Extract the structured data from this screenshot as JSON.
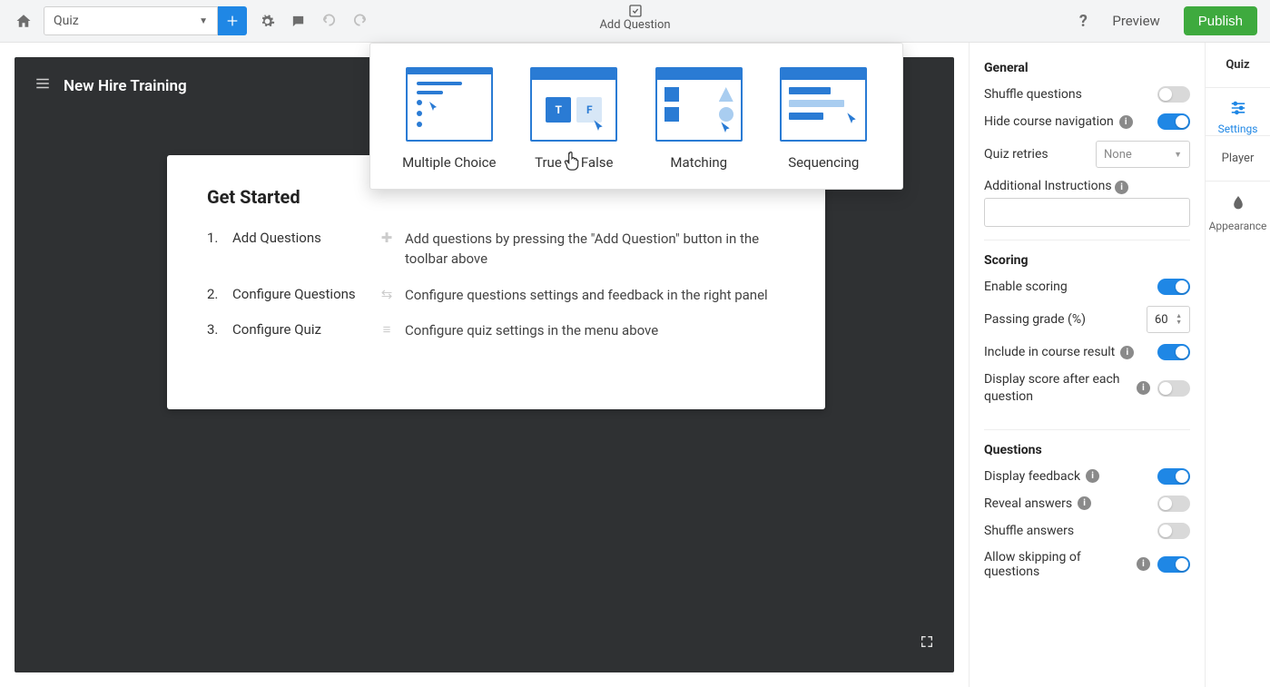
{
  "toolbar": {
    "quiz_select_label": "Quiz",
    "add_question_label": "Add Question",
    "preview_label": "Preview",
    "publish_label": "Publish"
  },
  "stage": {
    "title": "New Hire Training",
    "card_title": "Get Started",
    "steps": [
      {
        "num": "1.",
        "title": "Add Questions",
        "desc": "Add questions by pressing the \"Add Question\" button in the toolbar above"
      },
      {
        "num": "2.",
        "title": "Configure Questions",
        "desc": "Configure questions settings and feedback in the right panel"
      },
      {
        "num": "3.",
        "title": "Configure Quiz",
        "desc": "Configure quiz settings in the menu above"
      }
    ]
  },
  "qtypes": {
    "multiple_choice": "Multiple Choice",
    "true_false": "True or False",
    "matching": "Matching",
    "sequencing": "Sequencing"
  },
  "settings": {
    "general_heading": "General",
    "shuffle_questions": "Shuffle questions",
    "hide_course_nav": "Hide course navigation",
    "quiz_retries": "Quiz retries",
    "quiz_retries_value": "None",
    "additional_instructions": "Additional Instructions",
    "scoring_heading": "Scoring",
    "enable_scoring": "Enable scoring",
    "passing_grade": "Passing grade (%)",
    "passing_grade_value": "60",
    "include_in_result": "Include in course result",
    "display_score_each": "Display score after each question",
    "questions_heading": "Questions",
    "display_feedback": "Display feedback",
    "reveal_answers": "Reveal answers",
    "shuffle_answers": "Shuffle answers",
    "allow_skipping": "Allow skipping of questions"
  },
  "rail": {
    "tab_quiz": "Quiz",
    "tab_player": "Player",
    "pill_settings": "Settings",
    "pill_appearance": "Appearance"
  }
}
